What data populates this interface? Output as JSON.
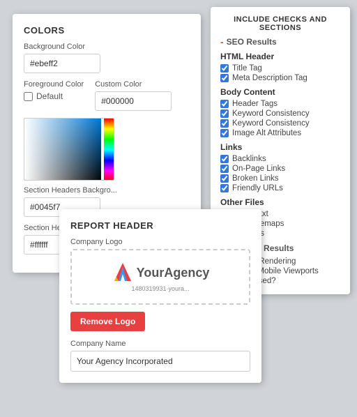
{
  "colors_panel": {
    "title": "COLORS",
    "background_color_label": "Background Color",
    "background_color_value": "#ebeff2",
    "foreground_color_label": "Foreground Color",
    "custom_color_label": "Custom Color",
    "custom_color_value": "#000000",
    "default_checkbox_label": "Default",
    "section_headers_bg_label": "Section Headers Backgro...",
    "section_headers_bg_value": "#0045f7",
    "section_headers_text_label": "Section Headers Text Color",
    "section_headers_text_value": "#ffffff"
  },
  "checks_panel": {
    "title": "INCLUDE CHECKS AND SECTIONS",
    "seo_toggle_label": "SEO Results",
    "sections": [
      {
        "name": "HTML Header",
        "items": [
          "Title Tag",
          "Meta Description Tag"
        ]
      },
      {
        "name": "Body Content",
        "items": [
          "Header Tags",
          "Keyword Consistency",
          "Keyword Consistency",
          "Image Alt Attributes"
        ]
      },
      {
        "name": "Links",
        "items": [
          "Backlinks",
          "On-Page Links",
          "Broken Links",
          "Friendly URLs"
        ]
      },
      {
        "name": "Other Files",
        "items": [
          "Robots.txt",
          "XML Sitemaps",
          "Analytics"
        ]
      }
    ],
    "usability_toggle_label": "Usability Results",
    "usability_items": [
      "Device Rendering",
      "Use of Mobile Viewports",
      "Flash used?"
    ]
  },
  "report_panel": {
    "title": "REPORT HEADER",
    "company_logo_label": "Company Logo",
    "logo_brand": "YourAgency",
    "logo_sub": "1480319931·youra...",
    "remove_logo_label": "Remove Logo",
    "company_name_label": "Company Name",
    "company_name_value": "Your Agency Incorporated"
  }
}
